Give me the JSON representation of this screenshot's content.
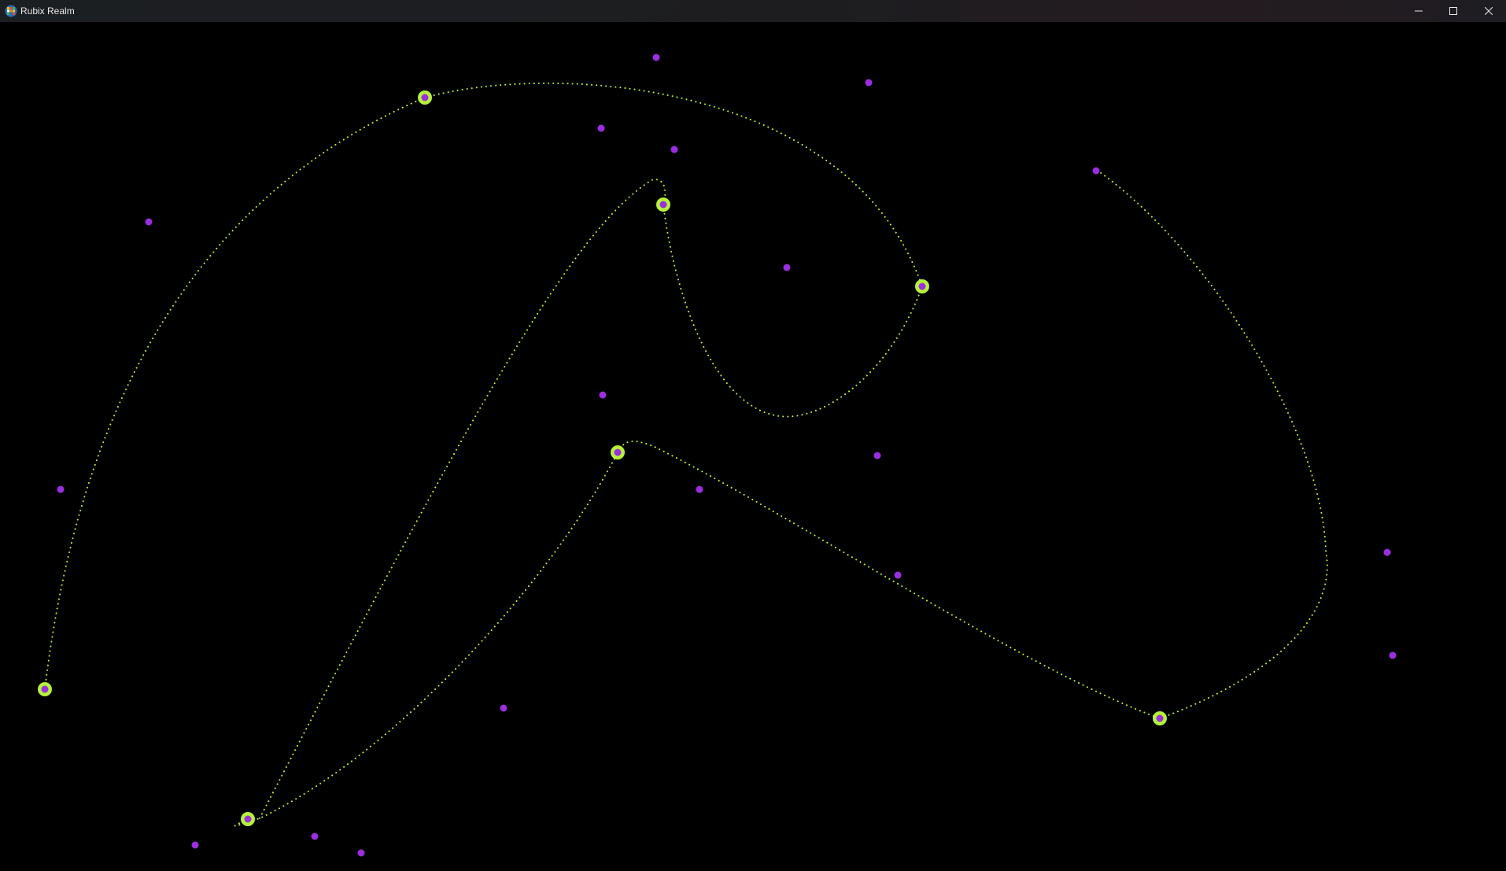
{
  "window": {
    "title": "Rubix Realm",
    "app_icon": "rubix-cube-icon",
    "controls": {
      "minimize": "minimize-icon",
      "maximize": "maximize-icon",
      "close": "close-icon"
    }
  },
  "colors": {
    "background": "#000000",
    "curve": "#b5f23a",
    "anchor_ring": "#b5f23a",
    "point": "#9b2ee0"
  },
  "scene": {
    "anchor_count": 7,
    "free_point_count": 18
  }
}
